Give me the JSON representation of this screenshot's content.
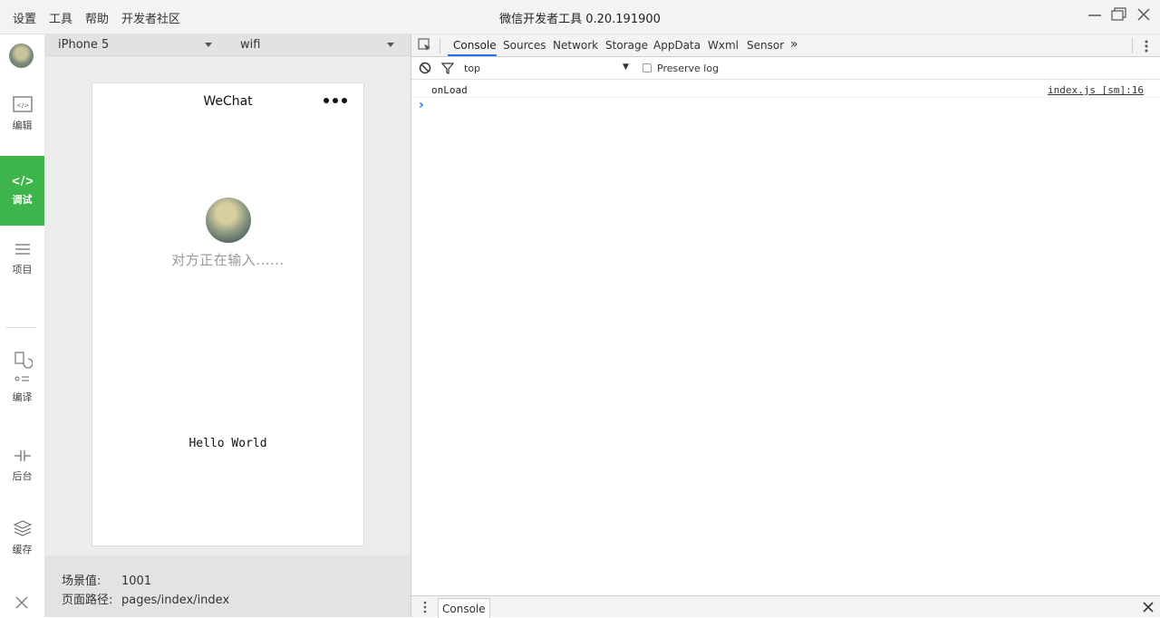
{
  "titlebar": {
    "menu": [
      "设置",
      "工具",
      "帮助",
      "开发者社区"
    ],
    "title": "微信开发者工具 0.20.191900"
  },
  "sidebar": {
    "items": [
      {
        "label": "编辑"
      },
      {
        "label": "调试"
      },
      {
        "label": "项目"
      },
      {
        "label": "编译"
      },
      {
        "label": "后台"
      },
      {
        "label": "缓存"
      }
    ]
  },
  "simulator": {
    "device": "iPhone 5",
    "network": "wifi",
    "phone": {
      "nav_title": "WeChat",
      "typing_text": "对方正在输入......",
      "body_text": "Hello World"
    },
    "footer": {
      "scene_label": "场景值:",
      "scene_value": "1001",
      "path_label": "页面路径:",
      "path_value": "pages/index/index"
    }
  },
  "devtools": {
    "tabs": [
      "Console",
      "Sources",
      "Network",
      "Storage",
      "AppData",
      "Wxml",
      "Sensor"
    ],
    "more": "»",
    "context": "top",
    "preserve_log": "Preserve log",
    "log": {
      "message": "onLoad",
      "source": "index.js [sm]:16"
    },
    "prompt": "›",
    "drawer_tab": "Console"
  },
  "colors": {
    "accent": "#3cb54a",
    "tab_underline": "#1a73e8"
  }
}
